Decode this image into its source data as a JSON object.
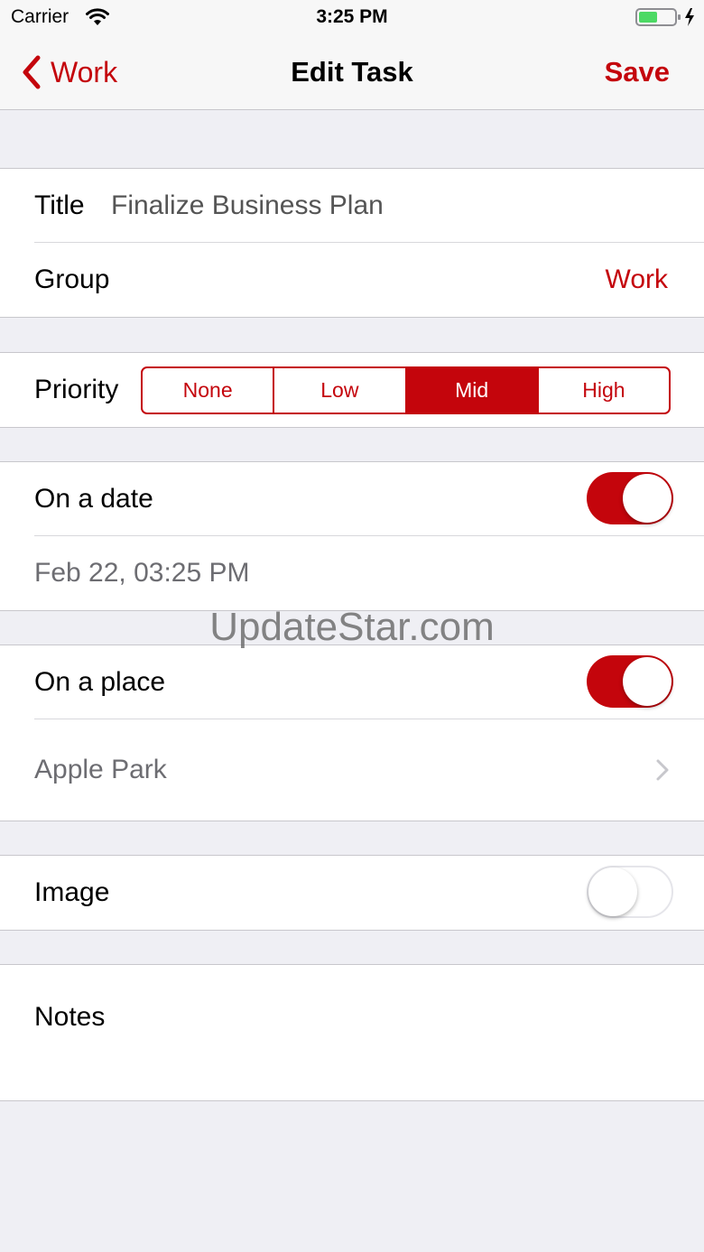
{
  "status_bar": {
    "carrier": "Carrier",
    "time": "3:25 PM"
  },
  "nav": {
    "back_label": "Work",
    "title": "Edit Task",
    "save_label": "Save"
  },
  "task": {
    "title_label": "Title",
    "title_value": "Finalize Business Plan",
    "group_label": "Group",
    "group_value": "Work",
    "priority_label": "Priority",
    "priority_options": [
      "None",
      "Low",
      "Mid",
      "High"
    ],
    "priority_selected": "Mid",
    "date_label": "On a date",
    "date_enabled": true,
    "date_value": "Feb 22, 03:25 PM",
    "place_label": "On a place",
    "place_enabled": true,
    "place_value": "Apple Park",
    "image_label": "Image",
    "image_enabled": false,
    "notes_label": "Notes"
  },
  "watermark": "UpdateStar.com",
  "colors": {
    "accent": "#c4050c",
    "background": "#efeff4",
    "separator": "#c8c7cc",
    "secondary_text": "#6d6d72",
    "battery_green": "#4cd964"
  }
}
